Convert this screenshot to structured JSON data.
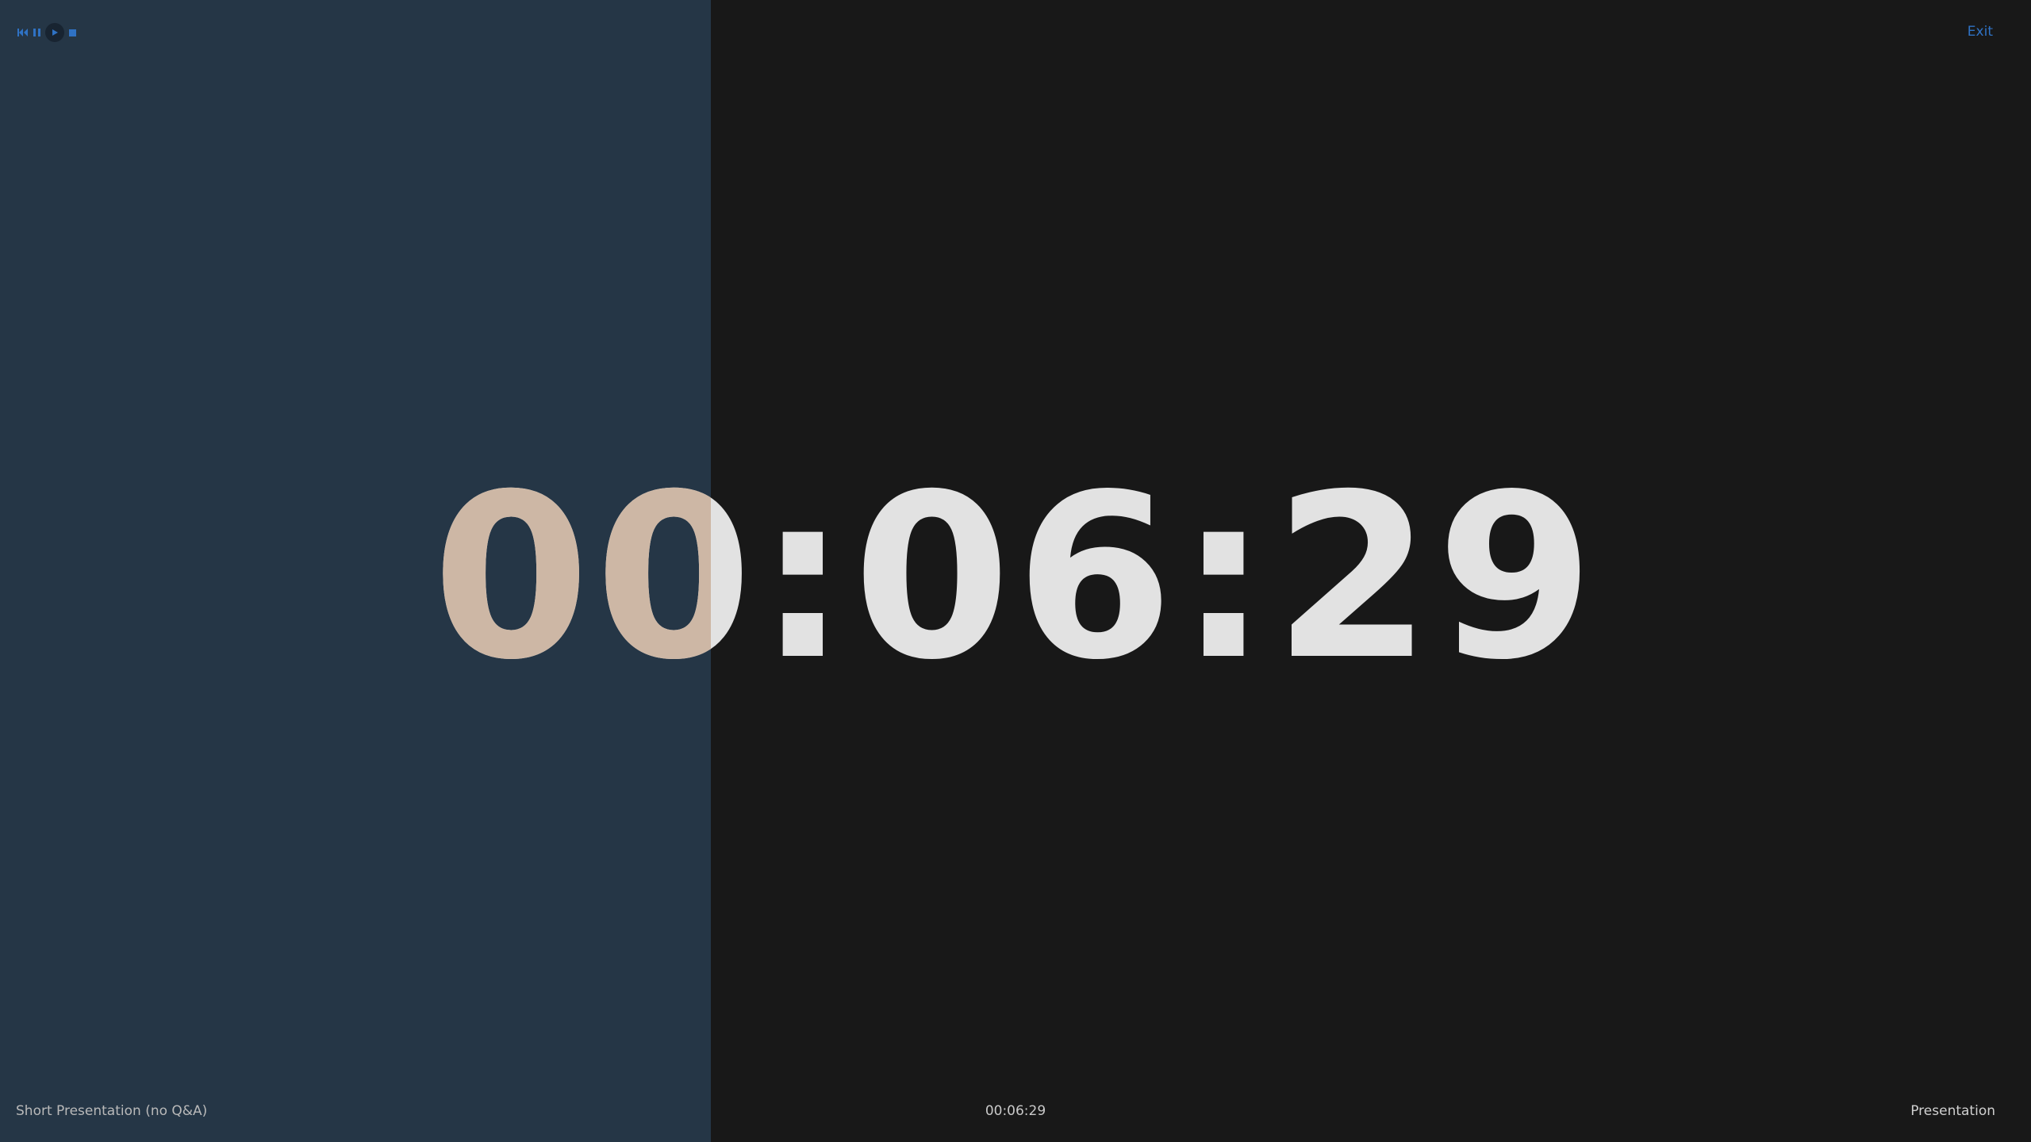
{
  "timer": {
    "display": "00:06:29",
    "elapsed_fraction": 0.35,
    "colors": {
      "background": "#181818",
      "progress": "#253646",
      "digits": "#e2e2e2",
      "digits_elapsed": "#cdb7a5",
      "accent": "#2f72c4"
    }
  },
  "controls": {
    "previous_icon": "skip-previous-icon",
    "pause_icon": "pause-icon",
    "play_icon": "play-icon",
    "stop_icon": "stop-icon"
  },
  "header": {
    "exit_label": "Exit"
  },
  "footer": {
    "left_label": "Short Presentation (no Q&A)",
    "center_time": "00:06:29",
    "right_label": "Presentation"
  }
}
